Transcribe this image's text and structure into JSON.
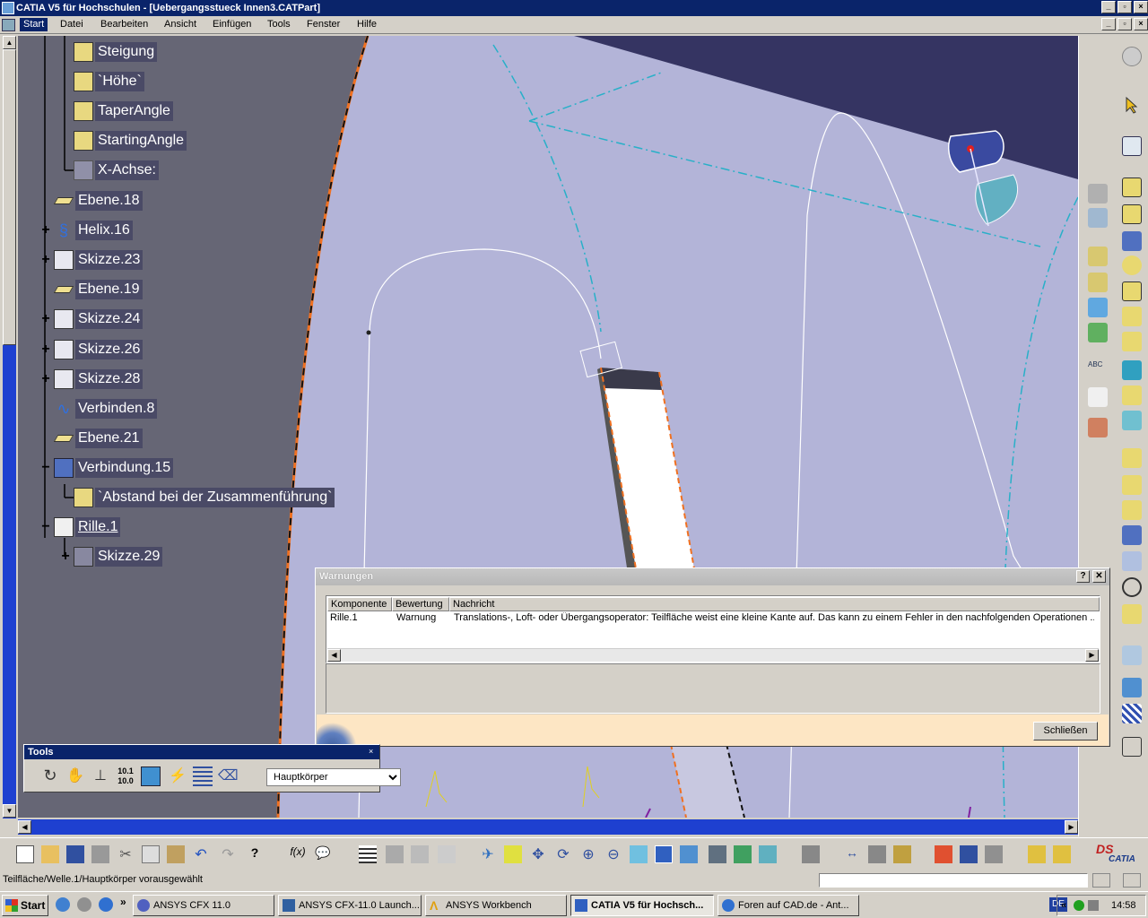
{
  "window": {
    "title": "CATIA V5 für Hochschulen - [Uebergangsstueck Innen3.CATPart]"
  },
  "menu": [
    "Start",
    "Datei",
    "Bearbeiten",
    "Ansicht",
    "Einfügen",
    "Tools",
    "Fenster",
    "Hilfe"
  ],
  "tree": [
    {
      "label": "Steigung",
      "icon": "parameter-icon"
    },
    {
      "label": "`Höhe`",
      "icon": "parameter-icon"
    },
    {
      "label": "TaperAngle",
      "icon": "parameter-icon"
    },
    {
      "label": "StartingAngle",
      "icon": "parameter-icon"
    },
    {
      "label": "X-Achse:",
      "icon": "axis-icon"
    },
    {
      "label": "Ebene.18",
      "icon": "plane-icon"
    },
    {
      "label": "Helix.16",
      "icon": "helix-icon",
      "expander": "+"
    },
    {
      "label": "Skizze.23",
      "icon": "sketch-icon",
      "expander": "+"
    },
    {
      "label": "Ebene.19",
      "icon": "plane-icon"
    },
    {
      "label": "Skizze.24",
      "icon": "sketch-icon",
      "expander": "+"
    },
    {
      "label": "Skizze.26",
      "icon": "sketch-icon",
      "expander": "+"
    },
    {
      "label": "Skizze.28",
      "icon": "sketch-icon",
      "expander": "+"
    },
    {
      "label": "Verbinden.8",
      "icon": "join-icon"
    },
    {
      "label": "Ebene.21",
      "icon": "plane-icon"
    },
    {
      "label": "Verbindung.15",
      "icon": "connect-icon",
      "expander": "−"
    },
    {
      "label": "`Abstand bei der Zusammenführung`",
      "icon": "parameter-icon"
    },
    {
      "label": "Rille.1",
      "icon": "groove-icon",
      "expander": "−"
    },
    {
      "label": "Skizze.29",
      "icon": "sketch-icon",
      "expander": "+"
    }
  ],
  "dialog": {
    "title": "Warnungen",
    "help": "?",
    "close_x": "✕",
    "columns": [
      "Komponente",
      "Bewertung",
      "Nachricht"
    ],
    "rows": [
      {
        "component": "Rille.1",
        "rating": "Warnung",
        "message": "Translations-, Loft- oder Übergangsoperator:  Teilfläche weist eine kleine Kante auf. Das kann zu einem Fehler in den nachfolgenden Operationen ..."
      }
    ],
    "close_button": "Schließen"
  },
  "tools_toolbar": {
    "title": "Tools",
    "body_select": "Hauptkörper",
    "icons": [
      "update-icon",
      "hand-icon",
      "axis-system-icon",
      "units-icon",
      "3d-support-icon",
      "snap-icon",
      "list-icon",
      "eraser-icon"
    ]
  },
  "status": {
    "text": "Teilfläche/Welle.1/Hauptkörper vorausgewählt"
  },
  "taskbar": {
    "start": "Start",
    "items": [
      {
        "label": "ANSYS CFX 11.0",
        "icon": "cfx-icon"
      },
      {
        "label": "ANSYS CFX-11.0 Launch...",
        "icon": "launch-icon"
      },
      {
        "label": "ANSYS Workbench",
        "icon": "workbench-icon"
      },
      {
        "label": "CATIA V5 für Hochsch...",
        "icon": "catia-icon",
        "active": true
      },
      {
        "label": "Foren auf CAD.de - Ant...",
        "icon": "ie-icon"
      }
    ],
    "lang": "DE",
    "clock": "14:58"
  },
  "colors": {
    "titlebar": "#0a246a",
    "tree_label_bg": "#4a4a66",
    "viewport_bg": "#b3b4d8",
    "dark_bg": "#353462",
    "scroll": "#1e40d0"
  },
  "brand": {
    "logo_text": "CATIA"
  }
}
